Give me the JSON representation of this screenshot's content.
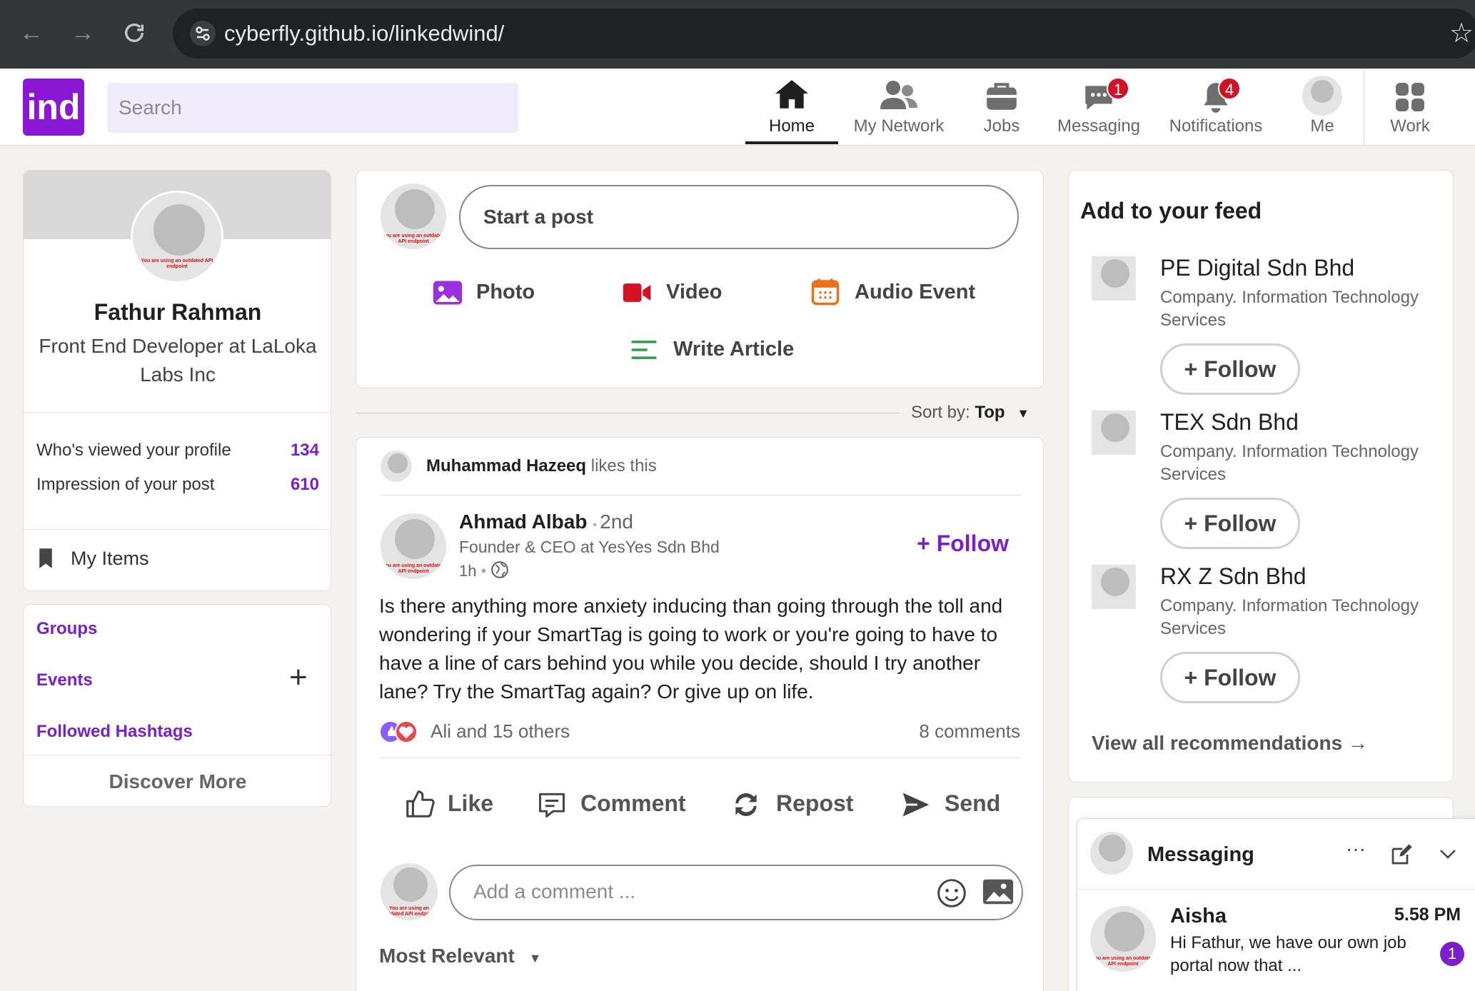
{
  "browser": {
    "url": "cyberfly.github.io/linkedwind/"
  },
  "header": {
    "logo": "ind",
    "search_placeholder": "Search",
    "nav": [
      {
        "label": "Home"
      },
      {
        "label": "My Network"
      },
      {
        "label": "Jobs"
      },
      {
        "label": "Messaging",
        "badge": "1"
      },
      {
        "label": "Notifications",
        "badge": "4"
      },
      {
        "label": "Me"
      },
      {
        "label": "Work"
      }
    ]
  },
  "profile": {
    "name": "Fathur Rahman",
    "title": "Front End Developer at LaLoka Labs Inc",
    "stats": [
      {
        "label": "Who's viewed your profile",
        "value": "134"
      },
      {
        "label": "Impression of your post",
        "value": "610"
      }
    ],
    "my_items": "My Items",
    "avatar_text": "You are using an outdated API endpoint"
  },
  "sidebar_links": {
    "groups": "Groups",
    "events": "Events",
    "hashtags": "Followed Hashtags",
    "discover": "Discover More"
  },
  "composer": {
    "placeholder": "Start a post",
    "actions": {
      "photo": "Photo",
      "video": "Video",
      "audio": "Audio Event",
      "article": "Write Article"
    }
  },
  "sort": {
    "label": "Sort by:",
    "value": "Top"
  },
  "post": {
    "liker": "Muhammad Hazeeq",
    "liker_suffix": "likes this",
    "author": "Ahmad Albab",
    "degree": "2nd",
    "author_title": "Founder & CEO at YesYes Sdn Bhd",
    "time": "1h",
    "follow": "+ Follow",
    "body": "Is there anything more anxiety inducing than going through the toll and wondering if your SmartTag is going to work or you're going to have to have a line of cars behind you while you decide, should I try another lane? Try the SmartTag again? Or give up on life.",
    "reactions": "Ali and 15 others",
    "comments": "8 comments",
    "actions": {
      "like": "Like",
      "comment": "Comment",
      "repost": "Repost",
      "send": "Send"
    },
    "comment_placeholder": "Add a comment ...",
    "most_relevant": "Most Relevant"
  },
  "feed_recs": {
    "title": "Add to your feed",
    "items": [
      {
        "name": "PE Digital Sdn Bhd",
        "desc": "Company. Information Technology Services",
        "follow": "+ Follow"
      },
      {
        "name": "TEX Sdn Bhd",
        "desc": "Company. Information Technology Services",
        "follow": "+ Follow"
      },
      {
        "name": "RX Z Sdn Bhd",
        "desc": "Company. Information Technology Services",
        "follow": "+ Follow"
      }
    ],
    "view_all": "View all recommendations →"
  },
  "messaging": {
    "title": "Messaging",
    "conversation": {
      "name": "Aisha",
      "time": "5.58 PM",
      "preview": "Hi Fathur, we have our own job portal now that ...",
      "unread": "1"
    }
  },
  "colors": {
    "brand": "#8a17d6",
    "accent": "#7a1fc9",
    "badge": "#d11124"
  }
}
